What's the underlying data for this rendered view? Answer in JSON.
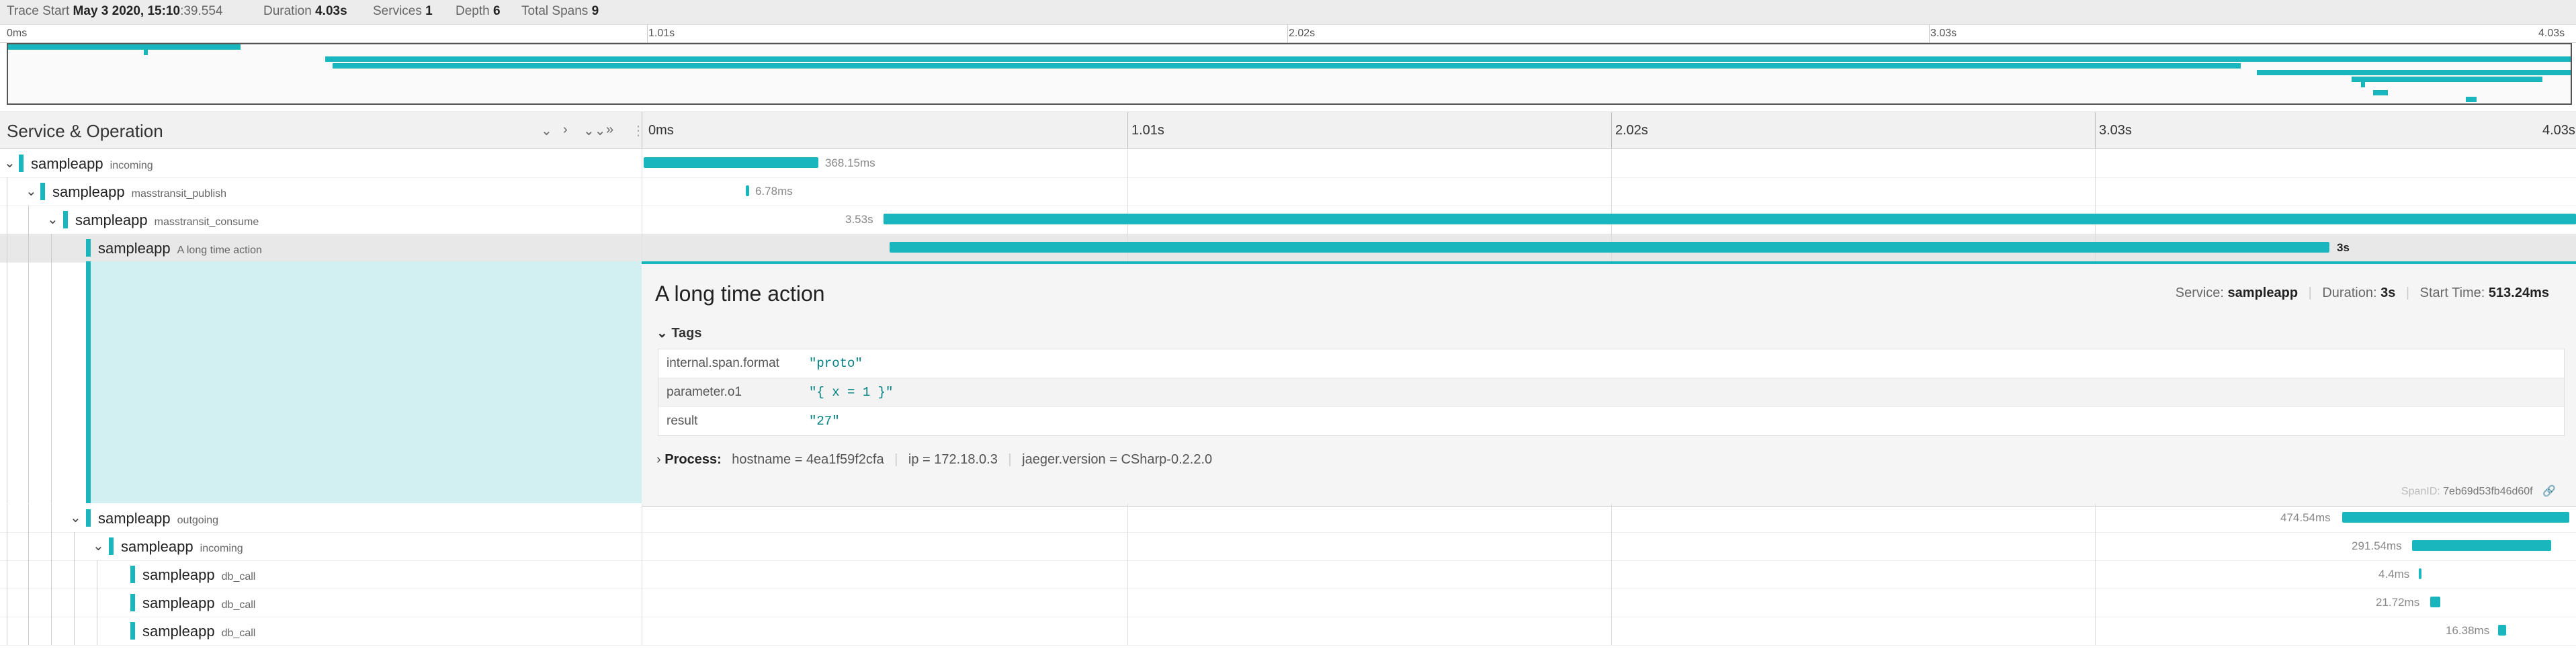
{
  "summary": {
    "trace_start_label": "Trace Start",
    "trace_start_date": "May 3 2020, 15:10",
    "trace_start_ms": ":39.554",
    "duration_label": "Duration",
    "duration": "4.03s",
    "services_label": "Services",
    "services": "1",
    "depth_label": "Depth",
    "depth": "6",
    "spans_label": "Total Spans",
    "spans": "9"
  },
  "minimap_ticks": [
    "0ms",
    "1.01s",
    "2.02s",
    "3.03s",
    "4.03s"
  ],
  "column_header": {
    "title": "Service & Operation",
    "ticks": [
      "0ms",
      "1.01s",
      "2.02s",
      "3.03s",
      "4.03s"
    ]
  },
  "rows": [
    {
      "service": "sampleapp",
      "operation": "incoming",
      "duration": "368.15ms"
    },
    {
      "service": "sampleapp",
      "operation": "masstransit_publish",
      "duration": "6.78ms"
    },
    {
      "service": "sampleapp",
      "operation": "masstransit_consume",
      "duration": "3.53s"
    },
    {
      "service": "sampleapp",
      "operation": "A long time action",
      "duration": "3s"
    },
    {
      "service": "sampleapp",
      "operation": "outgoing",
      "duration": "474.54ms"
    },
    {
      "service": "sampleapp",
      "operation": "incoming",
      "duration": "291.54ms"
    },
    {
      "service": "sampleapp",
      "operation": "db_call",
      "duration": "4.4ms"
    },
    {
      "service": "sampleapp",
      "operation": "db_call",
      "duration": "21.72ms"
    },
    {
      "service": "sampleapp",
      "operation": "db_call",
      "duration": "16.38ms"
    }
  ],
  "detail": {
    "title": "A long time action",
    "service_label": "Service:",
    "service": "sampleapp",
    "duration_label": "Duration:",
    "duration": "3s",
    "start_label": "Start Time:",
    "start": "513.24ms",
    "tags_label": "Tags",
    "tags": [
      {
        "key": "internal.span.format",
        "value": "\"proto\""
      },
      {
        "key": "parameter.o1",
        "value": "\"{ x = 1 }\""
      },
      {
        "key": "result",
        "value": "\"27\""
      }
    ],
    "process_label": "Process:",
    "process": [
      {
        "key": "hostname",
        "value": "4ea1f59f2cfa"
      },
      {
        "key": "ip",
        "value": "172.18.0.3"
      },
      {
        "key": "jaeger.version",
        "value": "CSharp-0.2.2.0"
      }
    ],
    "spanid_label": "SpanID:",
    "spanid": "7eb69d53fb46d60f"
  },
  "colors": {
    "accent": "#19b7bd",
    "detail_bg": "#d2f0f1"
  },
  "icons": [
    "chevron-down-icon",
    "chevron-right-icon",
    "double-chevron-down-icon",
    "double-chevron-right-icon",
    "link-icon"
  ]
}
